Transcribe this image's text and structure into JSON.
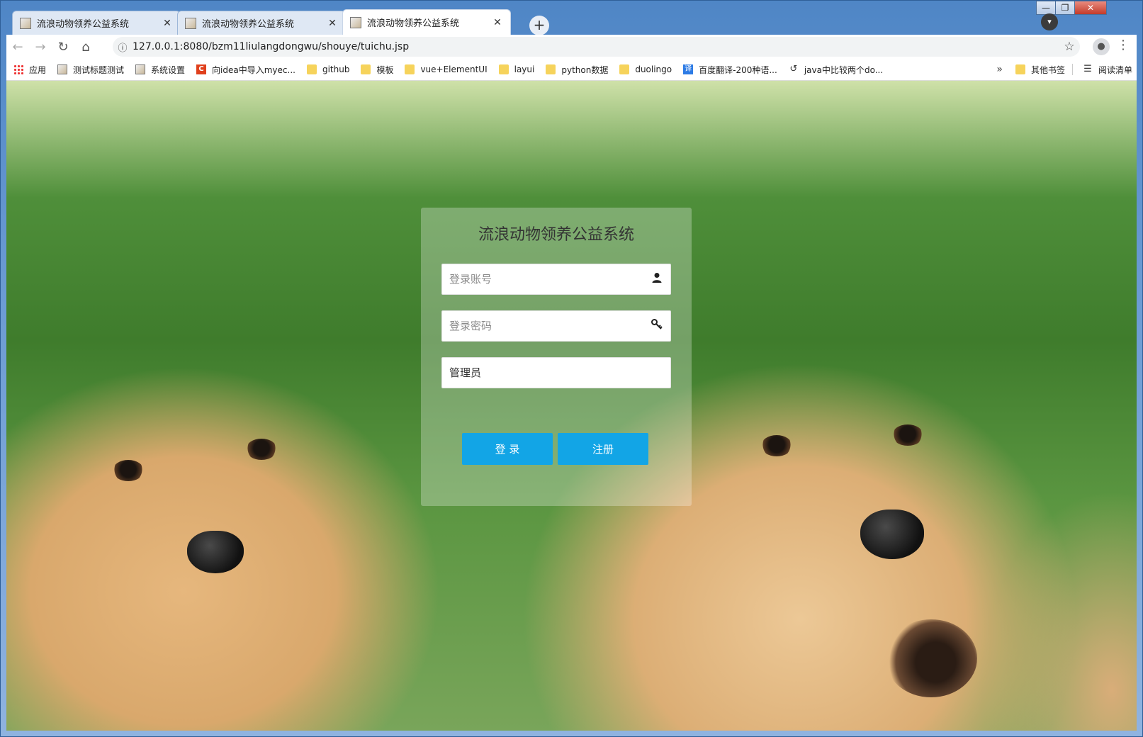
{
  "browser": {
    "tabs": [
      {
        "title": "流浪动物领养公益系统",
        "close": "✕"
      },
      {
        "title": "流浪动物领养公益系统",
        "close": "✕"
      },
      {
        "title": "流浪动物领养公益系统",
        "close": "✕"
      }
    ],
    "new_tab": "+",
    "url": "127.0.0.1:8080/bzm11liulangdongwu/shouye/tuichu.jsp",
    "window_controls": {
      "minimize": "—",
      "maximize": "❐",
      "close": "✕"
    }
  },
  "bookmarks": {
    "items": [
      {
        "label": "应用",
        "icon": "apps-icon"
      },
      {
        "label": "测试标题测试",
        "icon": "page-icon"
      },
      {
        "label": "系统设置",
        "icon": "page-icon"
      },
      {
        "label": "向idea中导入myec...",
        "icon": "c-logo-icon"
      },
      {
        "label": "github",
        "icon": "folder-icon"
      },
      {
        "label": "模板",
        "icon": "folder-icon"
      },
      {
        "label": "vue+ElementUI",
        "icon": "folder-icon"
      },
      {
        "label": "layui",
        "icon": "folder-icon"
      },
      {
        "label": "python数据",
        "icon": "folder-icon"
      },
      {
        "label": "duolingo",
        "icon": "folder-icon"
      },
      {
        "label": "百度翻译-200种语...",
        "icon": "translate-icon"
      },
      {
        "label": "java中比较两个do...",
        "icon": "link-icon"
      }
    ],
    "overflow": "»",
    "other_bookmarks": "其他书签",
    "reading_list": "阅读清单",
    "icon_glyphs": {
      "c_logo": "C",
      "translate": "译",
      "link": "↺"
    }
  },
  "login": {
    "title": "流浪动物领养公益系统",
    "account_placeholder": "登录账号",
    "password_placeholder": "登录密码",
    "role_selected": "管理员",
    "login_button": "登 录",
    "register_button": "注册"
  },
  "colors": {
    "primary_button": "#12a5e6",
    "panel_overlay": "rgba(255,255,255,0.28)"
  }
}
